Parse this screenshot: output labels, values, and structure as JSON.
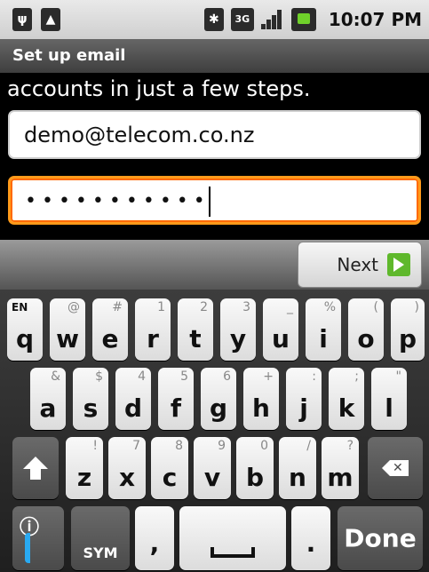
{
  "status_bar": {
    "time": "10:07 PM",
    "network_label": "3G"
  },
  "title_bar": {
    "title": "Set up email"
  },
  "content": {
    "intro_text": "accounts in just a few steps.",
    "email_value": "demo@telecom.co.nz",
    "password_mask": "•••••••••••"
  },
  "button_bar": {
    "next_label": "Next"
  },
  "keyboard": {
    "lang_label": "EN",
    "row1": [
      {
        "main": "q",
        "alt": ""
      },
      {
        "main": "w",
        "alt": "@"
      },
      {
        "main": "e",
        "alt": "#"
      },
      {
        "main": "r",
        "alt": "1"
      },
      {
        "main": "t",
        "alt": "2"
      },
      {
        "main": "y",
        "alt": "3"
      },
      {
        "main": "u",
        "alt": "_"
      },
      {
        "main": "i",
        "alt": "%"
      },
      {
        "main": "o",
        "alt": "("
      },
      {
        "main": "p",
        "alt": ")"
      }
    ],
    "row2": [
      {
        "main": "a",
        "alt": "&"
      },
      {
        "main": "s",
        "alt": "$"
      },
      {
        "main": "d",
        "alt": "4"
      },
      {
        "main": "f",
        "alt": "5"
      },
      {
        "main": "g",
        "alt": "6"
      },
      {
        "main": "h",
        "alt": "+"
      },
      {
        "main": "j",
        "alt": ":"
      },
      {
        "main": "k",
        "alt": ";"
      },
      {
        "main": "l",
        "alt": "\""
      }
    ],
    "row3": [
      {
        "main": "z",
        "alt": "!"
      },
      {
        "main": "x",
        "alt": "7"
      },
      {
        "main": "c",
        "alt": "8"
      },
      {
        "main": "v",
        "alt": "9"
      },
      {
        "main": "b",
        "alt": "0"
      },
      {
        "main": "n",
        "alt": "/"
      },
      {
        "main": "m",
        "alt": "?"
      }
    ],
    "sym_label": "SYM",
    "comma_label": ",",
    "period_label": ".",
    "done_label": "Done"
  }
}
